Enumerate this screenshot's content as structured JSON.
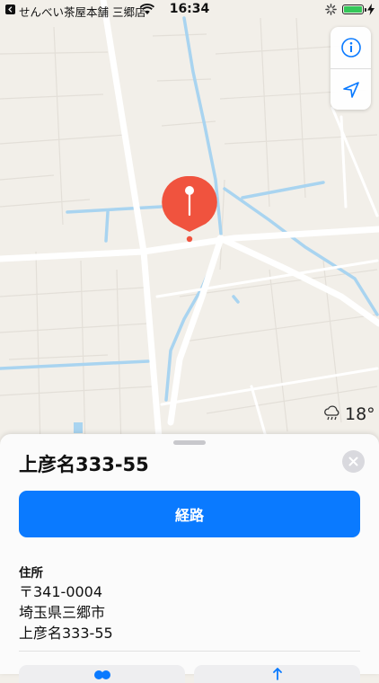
{
  "status_bar": {
    "carrier": "せんべい茶屋本舗 三郷店",
    "time": "16:34"
  },
  "map": {
    "weather": {
      "temperature": "18°",
      "icon": "cloud-rain-icon"
    }
  },
  "sheet": {
    "title": "上彦名333-55",
    "route_label": "経路",
    "address_label": "住所",
    "address_lines": [
      "〒341-0004",
      "埼玉県三郷市",
      "上彦名333-55"
    ]
  },
  "colors": {
    "accent": "#0a7aff",
    "pin": "#f0533e",
    "water": "#a9d4f0",
    "road": "#ffffff",
    "land": "#f2efe9"
  }
}
